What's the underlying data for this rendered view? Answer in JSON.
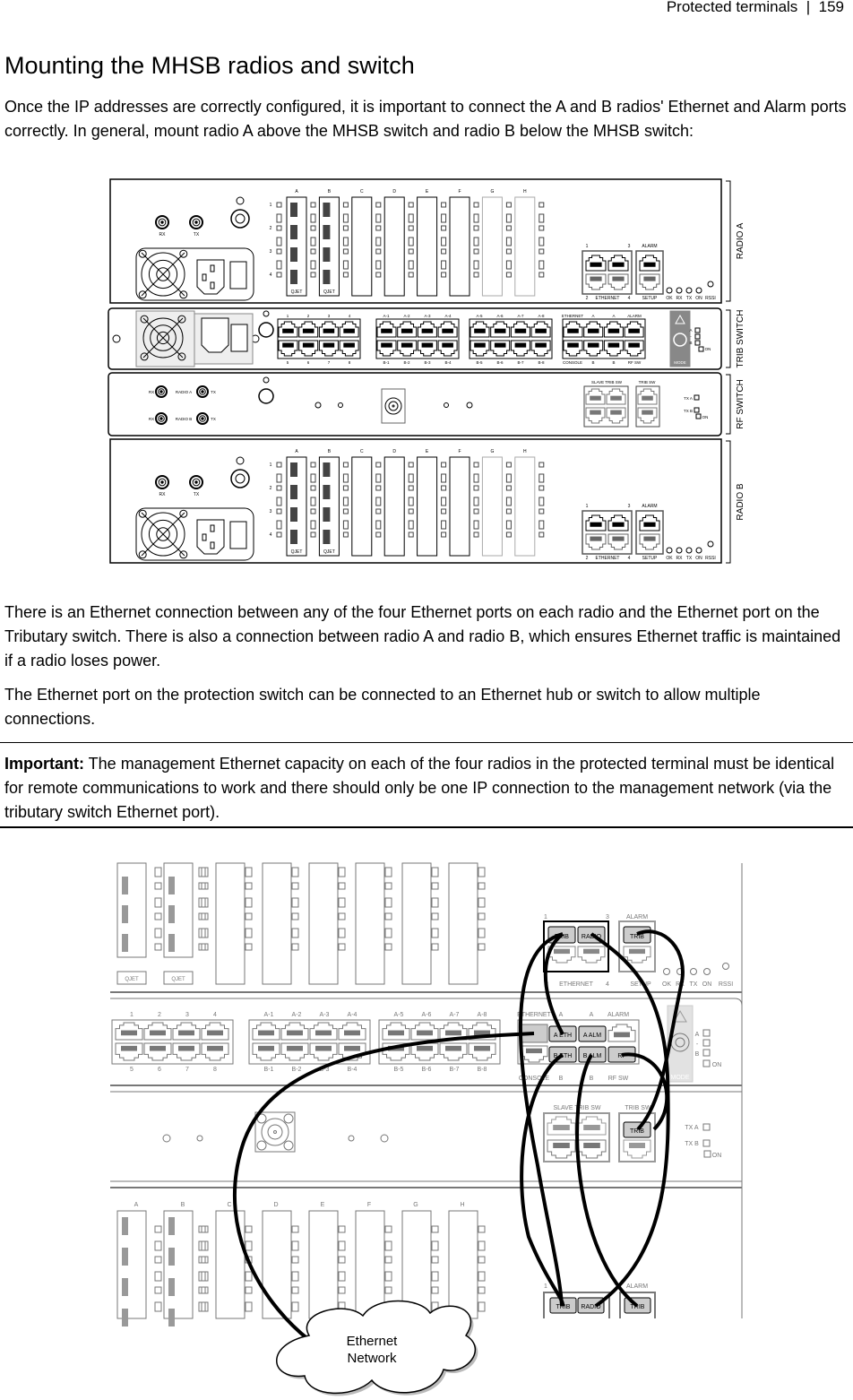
{
  "header": {
    "section": "Protected terminals",
    "separator": "|",
    "page_number": "159"
  },
  "title": "Mounting the MHSB radios and switch",
  "intro": "Once the IP addresses are correctly configured, it is important to connect the A and B radios' Ethernet and Alarm ports correctly. In general, mount radio A above the MHSB switch and radio B below the MHSB switch:",
  "figure1": {
    "side_labels": [
      "RADIO A",
      "TRIB SWITCH",
      "RF SWITCH",
      "RADIO B"
    ],
    "radio": {
      "connectors": [
        "RX",
        "TX"
      ],
      "slots": [
        "A",
        "B",
        "C",
        "D",
        "E",
        "F",
        "G",
        "H"
      ],
      "row_numbers": [
        "1",
        "2",
        "3",
        "4"
      ],
      "card_label": "QJET",
      "ethernet_top": [
        "1",
        "3"
      ],
      "ethernet_bottom": [
        "2",
        "ETHERNET",
        "4"
      ],
      "alarm_label": "ALARM",
      "setup_label": "SETUP",
      "leds": [
        "OK",
        "RX",
        "TX",
        "ON"
      ],
      "rssi": "RSSI"
    },
    "trib_switch": {
      "group1_top": [
        "1",
        "2",
        "3",
        "4"
      ],
      "group1_bottom": [
        "5",
        "6",
        "7",
        "8"
      ],
      "group2_top": [
        "A-1",
        "A-2",
        "A-3",
        "A-4"
      ],
      "group2_bottom": [
        "B-1",
        "B-2",
        "B-3",
        "B-4"
      ],
      "group3_top": [
        "A-5",
        "A-6",
        "A-7",
        "A-8"
      ],
      "group3_bottom": [
        "B-5",
        "B-6",
        "B-7",
        "B-8"
      ],
      "group4_top": [
        "ETHERNET",
        "A",
        "A",
        "ALARM"
      ],
      "group4_bottom": [
        "CONSOLE",
        "B",
        "B",
        "RF SW"
      ],
      "mode_label": "MODE",
      "indicators": [
        "A",
        "-",
        "B",
        "ON"
      ]
    },
    "rf_switch": {
      "radio_a": [
        "RX",
        "RADIO A",
        "TX"
      ],
      "radio_b": [
        "RX",
        "RADIO B",
        "TX"
      ],
      "slave_label": "SLAVE TRIB SW",
      "trib_label": "TRIB SW",
      "indicators": [
        "TX A",
        "TX B",
        "ON"
      ]
    }
  },
  "paragraph1": "There is an Ethernet connection between any of the four Ethernet ports on each radio and the Ethernet port on the Tributary switch. There is also a connection between radio A and radio B, which ensures Ethernet traffic is maintained if a radio loses power.",
  "paragraph2": "The Ethernet port on the protection switch can be connected to an Ethernet hub or switch to allow multiple connections.",
  "note": {
    "label": "Important:",
    "text": " The management Ethernet capacity on each of the four radios in the protected terminal must be identical for remote communications to work and there should only be one IP connection to the management network (via the tributary switch Ethernet port)."
  },
  "figure2": {
    "card_label": "QJET",
    "radio_a_ports": {
      "top_numbers": [
        "1",
        "3"
      ],
      "bottom": [
        "2",
        "ETHERNET",
        "4"
      ],
      "alarm": "ALARM",
      "setup": "SETUP",
      "plugs": [
        "TRIB",
        "RADIO",
        "TRIB"
      ],
      "leds": [
        "OK",
        "RX",
        "TX",
        "ON"
      ],
      "rssi": "RSSI"
    },
    "trib_switch": {
      "group1_top": [
        "1",
        "2",
        "3",
        "4"
      ],
      "group1_bottom": [
        "5",
        "6",
        "7",
        "8"
      ],
      "group2_top": [
        "A-1",
        "A-2",
        "A-3",
        "A-4"
      ],
      "group2_bottom": [
        "B-1",
        "B-2",
        "B-3",
        "B-4"
      ],
      "group3_top": [
        "A-5",
        "A-6",
        "A-7",
        "A-8"
      ],
      "group3_bottom": [
        "B-5",
        "B-6",
        "B-7",
        "B-8"
      ],
      "group4_top": [
        "ETHERNET",
        "A",
        "A",
        "ALARM"
      ],
      "group4_bottom": [
        "CONSOLE",
        "B",
        "B",
        "RF SW"
      ],
      "plugs_top": [
        "A ETH",
        "A ALM"
      ],
      "plugs_bottom": [
        "B ETH",
        "B ALM",
        "RF"
      ],
      "mode_label": "MODE",
      "indicators": [
        "A",
        "-",
        "B",
        "ON"
      ]
    },
    "rf_switch": {
      "slave_label": "SLAVE TRIB SW",
      "trib_label": "TRIB SW",
      "plug": "TRIB",
      "indicators": [
        "TX A",
        "TX B",
        "ON"
      ]
    },
    "radio_b": {
      "slots": [
        "A",
        "B",
        "C",
        "D",
        "E",
        "F",
        "G",
        "H"
      ],
      "top_number": "1",
      "alarm": "ALARM",
      "plugs": [
        "TRIB",
        "RADIO",
        "TRIB"
      ]
    },
    "cloud_line1": "Ethernet",
    "cloud_line2": "Network"
  }
}
